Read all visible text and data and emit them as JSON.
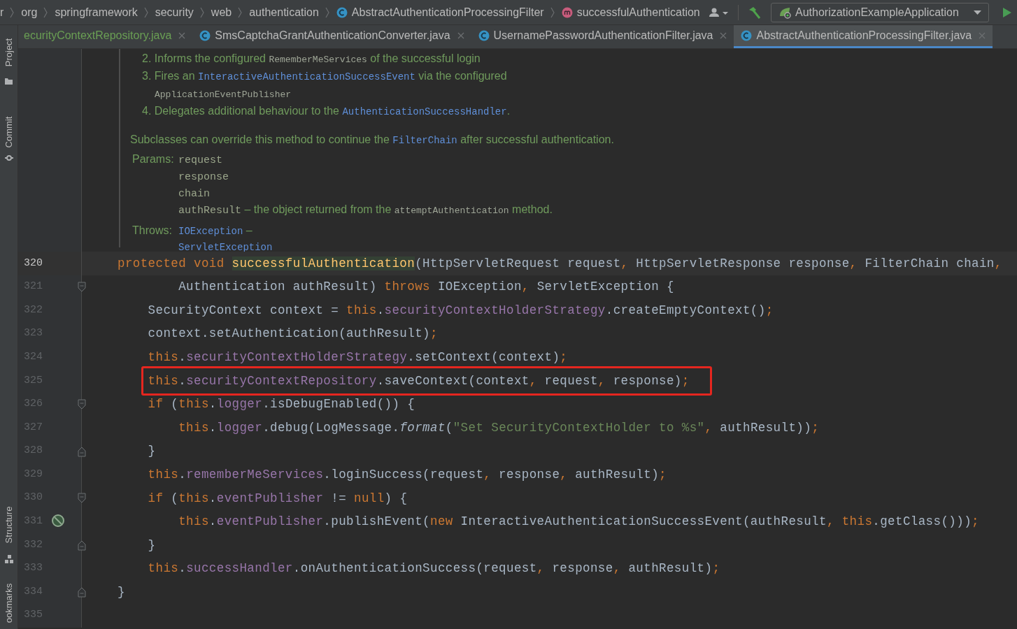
{
  "breadcrumbs": [
    {
      "label": "r",
      "kind": "package"
    },
    {
      "label": "org",
      "kind": "package"
    },
    {
      "label": "springframework",
      "kind": "package"
    },
    {
      "label": "security",
      "kind": "package"
    },
    {
      "label": "web",
      "kind": "package"
    },
    {
      "label": "authentication",
      "kind": "package"
    },
    {
      "label": "AbstractAuthenticationProcessingFilter",
      "kind": "class"
    },
    {
      "label": "successfulAuthentication",
      "kind": "method"
    }
  ],
  "run_config": {
    "label": "AuthorizationExampleApplication"
  },
  "tabs": [
    {
      "label": "ecurityContextRepository.java",
      "kind": "cut",
      "color": "#6a9f54",
      "selected": false
    },
    {
      "label": "SmsCaptchaGrantAuthenticationConverter.java",
      "kind": "class",
      "color": "#bbbbbb",
      "selected": false
    },
    {
      "label": "UsernamePasswordAuthenticationFilter.java",
      "kind": "class",
      "color": "#bbbbbb",
      "selected": false
    },
    {
      "label": "AbstractAuthenticationProcessingFilter.java",
      "kind": "class",
      "color": "#bbbbbb",
      "selected": true
    }
  ],
  "side_tools": [
    {
      "label": "Project",
      "kind": "folder"
    },
    {
      "label": "Commit",
      "kind": "commit"
    },
    {
      "label": "Structure",
      "kind": "structure"
    },
    {
      "label": "ookmarks",
      "kind": "bookmarks"
    }
  ],
  "doc": {
    "list": [
      {
        "parts": [
          {
            "kind": "text",
            "text": "2. Informs the configured "
          },
          {
            "kind": "code",
            "text": "RememberMeServices"
          },
          {
            "kind": "text",
            "text": " of the successful login"
          }
        ]
      },
      {
        "parts": [
          {
            "kind": "text",
            "text": "3. Fires an "
          },
          {
            "kind": "link",
            "text": "InteractiveAuthenticationSuccessEvent"
          },
          {
            "kind": "text",
            "text": " via the configured "
          },
          {
            "kind": "code",
            "text": "ApplicationEventPublisher"
          }
        ]
      },
      {
        "parts": [
          {
            "kind": "text",
            "text": "4. Delegates additional behaviour to the "
          },
          {
            "kind": "link",
            "text": "AuthenticationSuccessHandler"
          },
          {
            "kind": "text",
            "text": "."
          }
        ]
      }
    ],
    "paragraph": [
      {
        "kind": "text",
        "text": "Subclasses can override this method to continue the "
      },
      {
        "kind": "link",
        "text": "FilterChain"
      },
      {
        "kind": "text",
        "text": " after successful authentication."
      }
    ],
    "params": {
      "label": "Params:",
      "entries": [
        [
          {
            "kind": "param",
            "text": "request"
          }
        ],
        [
          {
            "kind": "param",
            "text": "response"
          }
        ],
        [
          {
            "kind": "param",
            "text": "chain"
          }
        ],
        [
          {
            "kind": "param",
            "text": "authResult"
          },
          {
            "kind": "text",
            "text": " – the object returned from the "
          },
          {
            "kind": "code",
            "text": "attemptAuthentication"
          },
          {
            "kind": "text",
            "text": " method."
          }
        ]
      ]
    },
    "throws": {
      "label": "Throws:",
      "entries": [
        [
          {
            "kind": "link",
            "text": "IOException"
          },
          {
            "kind": "text",
            "text": " –"
          }
        ],
        [
          {
            "kind": "link",
            "text": "ServletException"
          }
        ]
      ]
    }
  },
  "code": {
    "lines": [
      {
        "number": "320",
        "current": true,
        "boxed": false,
        "fold_open": false,
        "fold_close": false,
        "gutter_icon": false,
        "tokens": [
          {
            "kind": "kw",
            "text": "protected void "
          },
          {
            "kind": "decl",
            "text": "successfulAuthentication"
          },
          {
            "kind": "txt",
            "text": "(HttpServletRequest request"
          },
          {
            "kind": "kw",
            "text": ", "
          },
          {
            "kind": "txt",
            "text": "HttpServletResponse response"
          },
          {
            "kind": "kw",
            "text": ", "
          },
          {
            "kind": "txt",
            "text": "FilterChain chain"
          },
          {
            "kind": "kw",
            "text": ","
          }
        ]
      },
      {
        "number": "321",
        "current": false,
        "boxed": false,
        "fold_open": true,
        "fold_close": false,
        "gutter_icon": false,
        "tokens": [
          {
            "kind": "txt",
            "text": "        Authentication authResult) "
          },
          {
            "kind": "kw",
            "text": "throws"
          },
          {
            "kind": "txt",
            "text": " IOException"
          },
          {
            "kind": "kw",
            "text": ", "
          },
          {
            "kind": "txt",
            "text": "ServletException {"
          }
        ]
      },
      {
        "number": "322",
        "current": false,
        "boxed": false,
        "fold_open": false,
        "fold_close": false,
        "gutter_icon": false,
        "tokens": [
          {
            "kind": "txt",
            "text": "    SecurityContext context = "
          },
          {
            "kind": "kw",
            "text": "this"
          },
          {
            "kind": "txt",
            "text": "."
          },
          {
            "kind": "field",
            "text": "securityContextHolderStrategy"
          },
          {
            "kind": "txt",
            "text": ".createEmptyContext()"
          },
          {
            "kind": "kw",
            "text": ";"
          }
        ]
      },
      {
        "number": "323",
        "current": false,
        "boxed": false,
        "fold_open": false,
        "fold_close": false,
        "gutter_icon": false,
        "tokens": [
          {
            "kind": "txt",
            "text": "    context.setAuthentication(authResult)"
          },
          {
            "kind": "kw",
            "text": ";"
          }
        ]
      },
      {
        "number": "324",
        "current": false,
        "boxed": false,
        "fold_open": false,
        "fold_close": false,
        "gutter_icon": false,
        "tokens": [
          {
            "kind": "kw",
            "text": "    this"
          },
          {
            "kind": "txt",
            "text": "."
          },
          {
            "kind": "field",
            "text": "securityContextHolderStrategy"
          },
          {
            "kind": "txt",
            "text": ".setContext(context)"
          },
          {
            "kind": "kw",
            "text": ";"
          }
        ]
      },
      {
        "number": "325",
        "current": false,
        "boxed": true,
        "fold_open": false,
        "fold_close": false,
        "gutter_icon": false,
        "tokens": [
          {
            "kind": "kw",
            "text": "    this"
          },
          {
            "kind": "txt",
            "text": "."
          },
          {
            "kind": "field",
            "text": "securityContextRepository"
          },
          {
            "kind": "txt",
            "text": ".saveContext(context"
          },
          {
            "kind": "kw",
            "text": ", "
          },
          {
            "kind": "txt",
            "text": "request"
          },
          {
            "kind": "kw",
            "text": ", "
          },
          {
            "kind": "txt",
            "text": "response)"
          },
          {
            "kind": "kw",
            "text": ";"
          }
        ]
      },
      {
        "number": "326",
        "current": false,
        "boxed": false,
        "fold_open": true,
        "fold_close": false,
        "gutter_icon": false,
        "tokens": [
          {
            "kind": "kw",
            "text": "    if"
          },
          {
            "kind": "txt",
            "text": " ("
          },
          {
            "kind": "kw",
            "text": "this"
          },
          {
            "kind": "txt",
            "text": "."
          },
          {
            "kind": "field",
            "text": "logger"
          },
          {
            "kind": "txt",
            "text": ".isDebugEnabled()) {"
          }
        ]
      },
      {
        "number": "327",
        "current": false,
        "boxed": false,
        "fold_open": false,
        "fold_close": false,
        "gutter_icon": false,
        "tokens": [
          {
            "kind": "kw",
            "text": "        this"
          },
          {
            "kind": "txt",
            "text": "."
          },
          {
            "kind": "field",
            "text": "logger"
          },
          {
            "kind": "txt",
            "text": ".debug(LogMessage."
          },
          {
            "kind": "it",
            "text": "format"
          },
          {
            "kind": "txt",
            "text": "("
          },
          {
            "kind": "str",
            "text": "\"Set SecurityContextHolder to %s\""
          },
          {
            "kind": "kw",
            "text": ", "
          },
          {
            "kind": "txt",
            "text": "authResult))"
          },
          {
            "kind": "kw",
            "text": ";"
          }
        ]
      },
      {
        "number": "328",
        "current": false,
        "boxed": false,
        "fold_open": false,
        "fold_close": true,
        "gutter_icon": false,
        "tokens": [
          {
            "kind": "txt",
            "text": "    }"
          }
        ]
      },
      {
        "number": "329",
        "current": false,
        "boxed": false,
        "fold_open": false,
        "fold_close": false,
        "gutter_icon": false,
        "tokens": [
          {
            "kind": "kw",
            "text": "    this"
          },
          {
            "kind": "txt",
            "text": "."
          },
          {
            "kind": "field",
            "text": "rememberMeServices"
          },
          {
            "kind": "txt",
            "text": ".loginSuccess(request"
          },
          {
            "kind": "kw",
            "text": ", "
          },
          {
            "kind": "txt",
            "text": "response"
          },
          {
            "kind": "kw",
            "text": ", "
          },
          {
            "kind": "txt",
            "text": "authResult)"
          },
          {
            "kind": "kw",
            "text": ";"
          }
        ]
      },
      {
        "number": "330",
        "current": false,
        "boxed": false,
        "fold_open": true,
        "fold_close": false,
        "gutter_icon": false,
        "tokens": [
          {
            "kind": "kw",
            "text": "    if"
          },
          {
            "kind": "txt",
            "text": " ("
          },
          {
            "kind": "kw",
            "text": "this"
          },
          {
            "kind": "txt",
            "text": "."
          },
          {
            "kind": "field",
            "text": "eventPublisher"
          },
          {
            "kind": "txt",
            "text": " != "
          },
          {
            "kind": "kw",
            "text": "null"
          },
          {
            "kind": "txt",
            "text": ") {"
          }
        ]
      },
      {
        "number": "331",
        "current": false,
        "boxed": false,
        "fold_open": false,
        "fold_close": false,
        "gutter_icon": true,
        "tokens": [
          {
            "kind": "kw",
            "text": "        this"
          },
          {
            "kind": "txt",
            "text": "."
          },
          {
            "kind": "field",
            "text": "eventPublisher"
          },
          {
            "kind": "txt",
            "text": ".publishEvent("
          },
          {
            "kind": "kw",
            "text": "new"
          },
          {
            "kind": "txt",
            "text": " InteractiveAuthenticationSuccessEvent(authResult"
          },
          {
            "kind": "kw",
            "text": ", this"
          },
          {
            "kind": "txt",
            "text": ".getClass()))"
          },
          {
            "kind": "kw",
            "text": ";"
          }
        ]
      },
      {
        "number": "332",
        "current": false,
        "boxed": false,
        "fold_open": false,
        "fold_close": true,
        "gutter_icon": false,
        "tokens": [
          {
            "kind": "txt",
            "text": "    }"
          }
        ]
      },
      {
        "number": "333",
        "current": false,
        "boxed": false,
        "fold_open": false,
        "fold_close": false,
        "gutter_icon": false,
        "tokens": [
          {
            "kind": "kw",
            "text": "    this"
          },
          {
            "kind": "txt",
            "text": "."
          },
          {
            "kind": "field",
            "text": "successHandler"
          },
          {
            "kind": "txt",
            "text": ".onAuthenticationSuccess(request"
          },
          {
            "kind": "kw",
            "text": ", "
          },
          {
            "kind": "txt",
            "text": "response"
          },
          {
            "kind": "kw",
            "text": ", "
          },
          {
            "kind": "txt",
            "text": "authResult)"
          },
          {
            "kind": "kw",
            "text": ";"
          }
        ]
      },
      {
        "number": "334",
        "current": false,
        "boxed": false,
        "fold_open": false,
        "fold_close": true,
        "gutter_icon": false,
        "tokens": [
          {
            "kind": "txt",
            "text": "}"
          }
        ]
      },
      {
        "number": "335",
        "current": false,
        "boxed": false,
        "fold_open": false,
        "fold_close": false,
        "gutter_icon": false
      }
    ]
  }
}
